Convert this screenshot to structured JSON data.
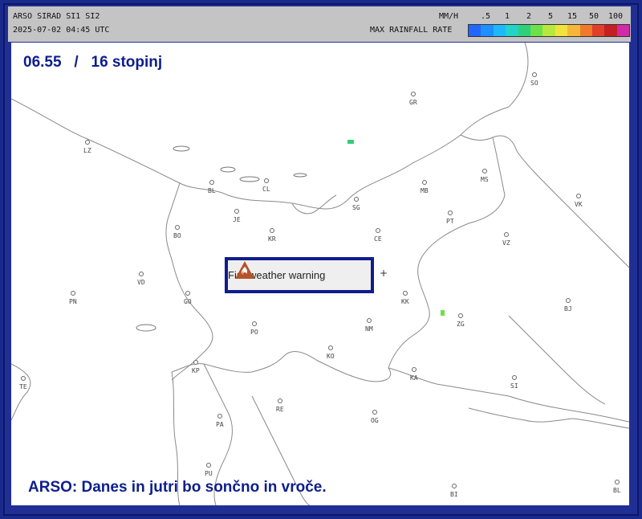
{
  "header": {
    "station": "ARSO SIRAD SI1 SI2",
    "timestamp": "2025-07-02 04:45 UTC",
    "unit": "MM/H",
    "rate_label": "MAX RAINFALL RATE",
    "scale_values": [
      ".5",
      "1",
      "2",
      "5",
      "15",
      "50",
      "100"
    ],
    "scale_colors": [
      "#2266ff",
      "#1e8fff",
      "#1fb8ff",
      "#22d3c8",
      "#30d07a",
      "#6ee04a",
      "#b8e83c",
      "#f0e43c",
      "#f5b63a",
      "#f07a2a",
      "#e0402a",
      "#c41f22",
      "#d02aa8"
    ]
  },
  "map": {
    "time_title": "06.55   /   16 stopinj",
    "caption": "ARSO:  Danes in jutri bo sončno in vroče.",
    "warning_label": "Fire weather warning",
    "cities": [
      "SO",
      "GR",
      "LZ",
      "BL",
      "CL",
      "MS",
      "VK",
      "MB",
      "SG",
      "JE",
      "PT",
      "BO",
      "KR",
      "CE",
      "VZ",
      "VD",
      "PN",
      "GO",
      "KK",
      "BJ",
      "NM",
      "ZG",
      "PO",
      "KO",
      "KP",
      "KA",
      "SI",
      "TE",
      "RE",
      "PA",
      "OG",
      "PU",
      "BI",
      "BL"
    ]
  },
  "icons": {
    "warning": "fire-icon",
    "center": "plus-icon"
  }
}
